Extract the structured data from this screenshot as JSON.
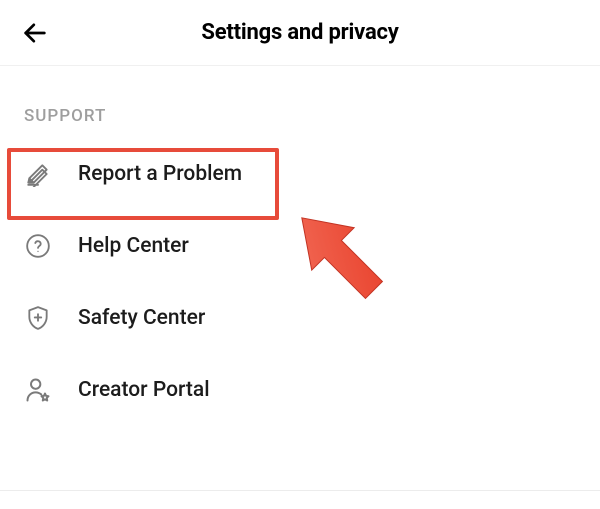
{
  "header": {
    "title": "Settings and privacy"
  },
  "section": {
    "label": "SUPPORT"
  },
  "menu": {
    "items": [
      {
        "label": "Report a Problem",
        "icon": "pencil-icon"
      },
      {
        "label": "Help Center",
        "icon": "question-circle-icon"
      },
      {
        "label": "Safety Center",
        "icon": "shield-plus-icon"
      },
      {
        "label": "Creator Portal",
        "icon": "person-star-icon"
      }
    ]
  },
  "annotation": {
    "highlight_color": "#e74b3a",
    "arrow_color": "#f05642"
  }
}
